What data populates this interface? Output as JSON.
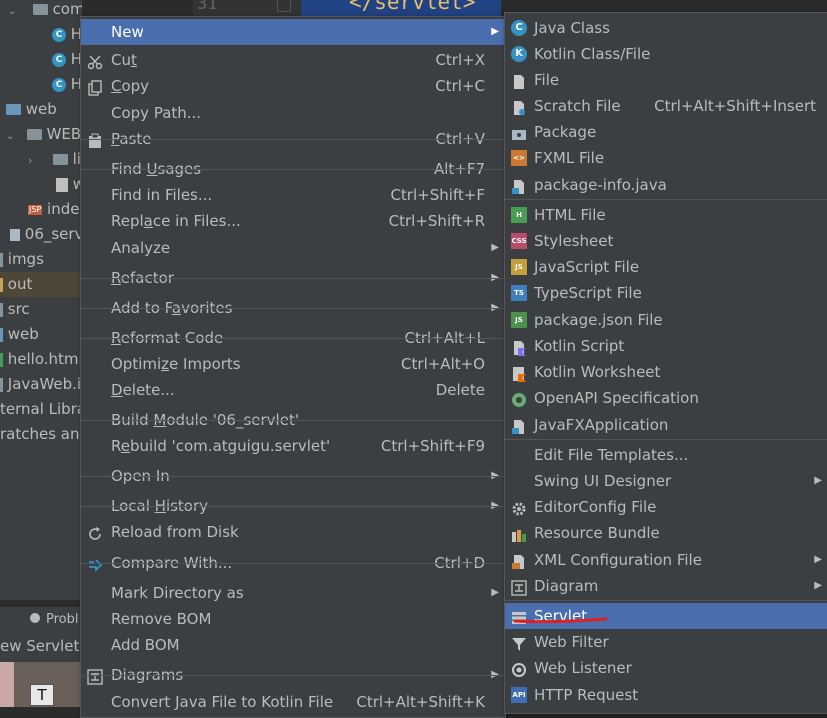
{
  "editor": {
    "line_number": "31",
    "code": "</servlet>"
  },
  "tree": {
    "items": [
      {
        "label": "com.atguigu.servle",
        "icon": "package-icon"
      },
      {
        "label": "H",
        "icon": "class-icon"
      },
      {
        "label": "H",
        "icon": "class-icon"
      },
      {
        "label": "H",
        "icon": "class-icon"
      },
      {
        "label": "web",
        "icon": "folder-icon"
      },
      {
        "label": "WEB",
        "icon": "folder-icon"
      },
      {
        "label": "li",
        "icon": "folder-icon"
      },
      {
        "label": "w",
        "icon": "file-icon"
      },
      {
        "label": "inde",
        "icon": "jsp-icon"
      },
      {
        "label": "06_serv",
        "icon": "module-icon"
      },
      {
        "label": "imgs",
        "icon": "folder-icon"
      },
      {
        "label": "out",
        "icon": "folder-icon"
      },
      {
        "label": "src",
        "icon": "folder-icon"
      },
      {
        "label": "web",
        "icon": "folder-icon"
      },
      {
        "label": "hello.html",
        "icon": "html-icon"
      },
      {
        "label": "JavaWeb.i",
        "icon": "iml-icon"
      },
      {
        "label": "ternal Libra",
        "icon": "library-icon"
      },
      {
        "label": "ratches and",
        "icon": "scratch-icon"
      }
    ],
    "bottom_tab": "Probl",
    "bottom_tab2": "ew Servlet",
    "thumb_label": "T"
  },
  "context_menu": {
    "items": [
      {
        "label": "New",
        "arrow": "▶",
        "active": true
      },
      {
        "label": "Cut",
        "u": "t",
        "shortcut": "Ctrl+X",
        "icon": "scissors-icon"
      },
      {
        "label": "Copy",
        "u": "C",
        "shortcut": "Ctrl+C",
        "icon": "copy-icon"
      },
      {
        "label": "Copy Path...",
        "shortcut": ""
      },
      {
        "label": "Paste",
        "u": "P",
        "shortcut": "Ctrl+V",
        "icon": "paste-icon"
      },
      {
        "label": "Find Usages",
        "u": "U",
        "shortcut": "Alt+F7"
      },
      {
        "label": "Find in Files...",
        "shortcut": "Ctrl+Shift+F"
      },
      {
        "label": "Replace in Files...",
        "u": "a",
        "shortcut": "Ctrl+Shift+R"
      },
      {
        "label": "Analyze",
        "arrow": "▶"
      },
      {
        "label": "Refactor",
        "u": "R",
        "arrow": "▶"
      },
      {
        "label": "Add to Favorites",
        "u": "a",
        "arrow": "▶"
      },
      {
        "label": "Reformat Code",
        "u": "R",
        "shortcut": "Ctrl+Alt+L"
      },
      {
        "label": "Optimize Imports",
        "u": "z",
        "shortcut": "Ctrl+Alt+O"
      },
      {
        "label": "Delete...",
        "u": "D",
        "shortcut": "Delete"
      },
      {
        "label": "Build Module '06_servlet'",
        "u": "M",
        "shortcut": ""
      },
      {
        "label": "Rebuild 'com.atguigu.servlet'",
        "u": "e",
        "shortcut": "Ctrl+Shift+F9"
      },
      {
        "label": "Open In",
        "arrow": "▶"
      },
      {
        "label": "Local History",
        "u": "H",
        "arrow": "▶"
      },
      {
        "label": "Reload from Disk",
        "icon": "reload-icon"
      },
      {
        "label": "Compare With...",
        "shortcut": "Ctrl+D",
        "icon": "compare-icon"
      },
      {
        "label": "Mark Directory as",
        "arrow": "▶"
      },
      {
        "label": "Remove BOM"
      },
      {
        "label": "Add BOM"
      },
      {
        "label": "Diagrams",
        "arrow": "▶",
        "icon": "diagram-icon"
      },
      {
        "label": "Convert Java File to Kotlin File",
        "shortcut": "Ctrl+Alt+Shift+K"
      }
    ]
  },
  "new_submenu": {
    "items": [
      {
        "label": "Java Class",
        "icon": "java-class-icon",
        "badge": "C",
        "color": "#3592c4"
      },
      {
        "label": "Kotlin Class/File",
        "icon": "kotlin-class-icon",
        "badge": "K",
        "color": "#3592c4"
      },
      {
        "label": "File",
        "icon": "file-icon"
      },
      {
        "label": "Scratch File",
        "shortcut": "Ctrl+Alt+Shift+Insert",
        "icon": "scratch-file-icon"
      },
      {
        "label": "Package",
        "icon": "package-icon"
      },
      {
        "label": "FXML File",
        "icon": "fxml-icon",
        "badge": "<>",
        "color": "#cc7832"
      },
      {
        "label": "package-info.java",
        "icon": "package-info-icon"
      },
      {
        "label": "HTML File",
        "icon": "html-file-icon",
        "badge": "H",
        "color": "#499c54"
      },
      {
        "label": "Stylesheet",
        "icon": "css-icon",
        "badge": "CSS",
        "color": "#b84c69"
      },
      {
        "label": "JavaScript File",
        "icon": "js-icon",
        "badge": "JS",
        "color": "#c4a03b"
      },
      {
        "label": "TypeScript File",
        "icon": "ts-icon",
        "badge": "TS",
        "color": "#3f7fbf"
      },
      {
        "label": "package.json File",
        "icon": "nodejs-icon",
        "badge": "JS",
        "color": "#4c9150"
      },
      {
        "label": "Kotlin Script",
        "icon": "kotlin-script-icon"
      },
      {
        "label": "Kotlin Worksheet",
        "icon": "kotlin-worksheet-icon"
      },
      {
        "label": "OpenAPI Specification",
        "icon": "openapi-icon"
      },
      {
        "label": "JavaFXApplication",
        "icon": "javafx-icon"
      },
      {
        "label": "Edit File Templates..."
      },
      {
        "label": "Swing UI Designer",
        "arrow": "▶"
      },
      {
        "label": "EditorConfig File",
        "icon": "gear-icon"
      },
      {
        "label": "Resource Bundle",
        "icon": "resource-bundle-icon"
      },
      {
        "label": "XML Configuration File",
        "arrow": "▶",
        "icon": "xml-icon"
      },
      {
        "label": "Diagram",
        "arrow": "▶",
        "icon": "diagram-icon"
      },
      {
        "label": "Servlet",
        "icon": "servlet-icon",
        "active": true
      },
      {
        "label": "Web Filter",
        "icon": "filter-icon"
      },
      {
        "label": "Web Listener",
        "icon": "listener-icon"
      },
      {
        "label": "HTTP Request",
        "icon": "api-icon",
        "badge": "API",
        "color": "#3f6fb5"
      }
    ]
  },
  "colors": {
    "highlight": "#4b6eaf",
    "annotation": "#e02020"
  }
}
